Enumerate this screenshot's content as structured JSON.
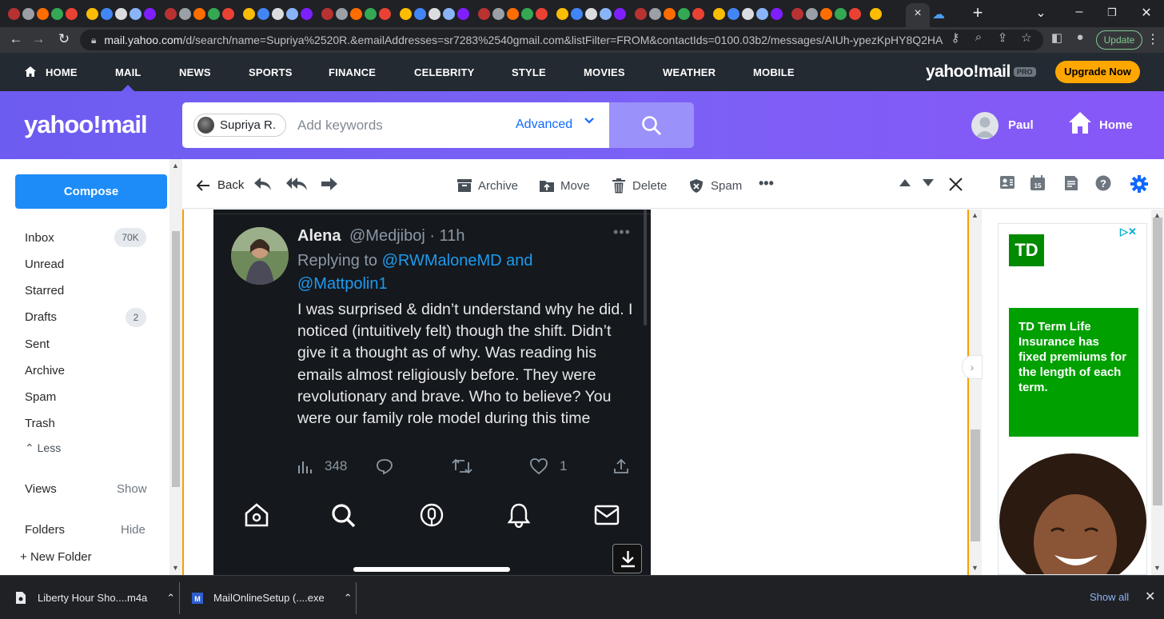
{
  "browser": {
    "url_host": "mail.yahoo.com",
    "url_rest": "/d/search/name=Supriya%2520R.&emailAddresses=sr7283%2540gmail.com&listFilter=FROM&contactIds=0100.03b2/messages/AIUh-ypezKpHY8Q2HAsX2E-2q...",
    "update_label": "Update",
    "new_tab": "+",
    "active_tab_close": "×"
  },
  "yahoo_nav": {
    "items": [
      "HOME",
      "MAIL",
      "NEWS",
      "SPORTS",
      "FINANCE",
      "CELEBRITY",
      "STYLE",
      "MOVIES",
      "WEATHER",
      "MOBILE"
    ],
    "logo": "yahoo!mail",
    "pro_badge": "PRO",
    "upgrade_label": "Upgrade Now"
  },
  "header": {
    "logo": "yahoo!mail",
    "search_chip": "Supriya R.",
    "search_placeholder": "Add keywords",
    "advanced_label": "Advanced",
    "user_name": "Paul",
    "home_label": "Home"
  },
  "sidebar": {
    "compose_label": "Compose",
    "folders": [
      {
        "label": "Inbox",
        "count": "70K"
      },
      {
        "label": "Unread"
      },
      {
        "label": "Starred"
      },
      {
        "label": "Drafts",
        "count": "2"
      },
      {
        "label": "Sent"
      },
      {
        "label": "Archive"
      },
      {
        "label": "Spam"
      },
      {
        "label": "Trash"
      }
    ],
    "less_label": "Less",
    "views_label": "Views",
    "views_action": "Show",
    "folders_label": "Folders",
    "folders_action": "Hide",
    "new_folder_label": "New Folder"
  },
  "toolbar": {
    "back_label": "Back",
    "archive_label": "Archive",
    "move_label": "Move",
    "delete_label": "Delete",
    "spam_label": "Spam",
    "more_label": "•••"
  },
  "tweet": {
    "name": "Alena",
    "handle_time": "@Medjiboj · 11h",
    "replying_prefix": "Replying to",
    "replying_users": "@RWMaloneMD and @Mattpolin1",
    "body": "I was surprised & didn’t understand why he did. I noticed (intuitively felt) though the shift. Didn’t give it a thought as of why. Was reading his emails almost religiously before. They were revolutionary and brave. Who to believe? You were our family role model during this time",
    "views": "348",
    "likes": "1",
    "more": "•••"
  },
  "ad": {
    "brand": "TD",
    "choices": "▷✕",
    "text": "TD Term Life Insurance has fixed premiums for the length of each term."
  },
  "downloads": {
    "items": [
      "Liberty Hour Sho....m4a",
      "MailOnlineSetup (....exe"
    ],
    "show_all": "Show all"
  }
}
